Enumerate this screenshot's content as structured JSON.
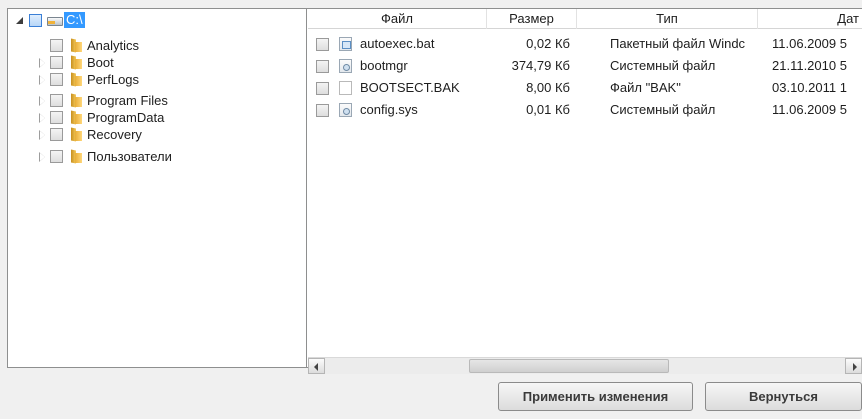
{
  "tree": {
    "root": {
      "label": "C:\\",
      "expanded": true
    },
    "items": [
      {
        "label": "Analytics",
        "has_children": false
      },
      {
        "label": "Boot",
        "has_children": true
      },
      {
        "label": "PerfLogs",
        "has_children": true
      },
      {
        "label": "Program Files",
        "has_children": true
      },
      {
        "label": "ProgramData",
        "has_children": true
      },
      {
        "label": "Recovery",
        "has_children": true
      },
      {
        "label": "Пользователи",
        "has_children": true
      }
    ]
  },
  "files": {
    "columns": {
      "name": "Файл",
      "size": "Размер",
      "type": "Тип",
      "date": "Дат"
    },
    "rows": [
      {
        "name": "autoexec.bat",
        "size": "0,02 Кб",
        "type": "Пакетный файл Windc",
        "date": "11.06.2009 5",
        "icon": "batch-file-icon"
      },
      {
        "name": "bootmgr",
        "size": "374,79 Кб",
        "type": "Системный файл",
        "date": "21.11.2010 5",
        "icon": "system-file-icon"
      },
      {
        "name": "BOOTSECT.BAK",
        "size": "8,00 Кб",
        "type": "Файл \"BAK\"",
        "date": "03.10.2011 1",
        "icon": "document-icon"
      },
      {
        "name": "config.sys",
        "size": "0,01 Кб",
        "type": "Системный файл",
        "date": "11.06.2009 5",
        "icon": "system-file-icon"
      }
    ]
  },
  "scrollbar": {
    "position_fraction": 0.45
  },
  "buttons": {
    "apply": "Применить изменения",
    "back": "Вернуться"
  },
  "colors": {
    "selection": "#3399ff",
    "border": "#8e8f8f"
  }
}
